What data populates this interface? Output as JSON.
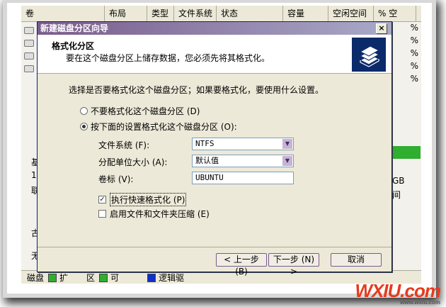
{
  "background_window": {
    "columns": [
      "卷",
      "布局",
      "类型",
      "文件系统",
      "状态",
      "容量",
      "空闲空间",
      "% 空"
    ],
    "pct_marker": "%",
    "side_fragments": [
      "基",
      "1",
      "联",
      "古",
      "无"
    ],
    "right_fragments": [
      "GB",
      "间"
    ],
    "legend": [
      "磁盘",
      "扩",
      "区",
      "可",
      "逻辑驱"
    ]
  },
  "dialog": {
    "title": "新建磁盘分区向导",
    "close": "×",
    "banner_title": "格式化分区",
    "banner_subtitle": "要在这个磁盘分区上储存数据，您必须先将其格式化。",
    "prompt": "选择是否要格式化这个磁盘分区；如果要格式化，要使用什么设置。",
    "radio_no_format": "不要格式化这个磁盘分区 (D)",
    "radio_format": "按下面的设置格式化这个磁盘分区 (O):",
    "fs_label": "文件系统 (F):",
    "fs_value": "NTFS",
    "alloc_label": "分配单位大小 (A):",
    "alloc_value": "默认值",
    "volume_label": "卷标 (V):",
    "volume_value": "UBUNTU",
    "quick_format": "执行快速格式化 (P)",
    "compress": "启用文件和文件夹压缩 (E)",
    "back_button": "< 上一步 (B)",
    "next_button": "下一步 (N) >",
    "cancel_button": "取消"
  },
  "watermark": {
    "logo": "WXIU.com",
    "sub": "www.wxiu.com"
  },
  "colors": {
    "title_start": "#7a5c8c",
    "title_end": "#a9a9c8",
    "banner_icon_bg": "#0a2a6a",
    "legend_green": "#2fae2f",
    "legend_blue": "#1030c8"
  }
}
